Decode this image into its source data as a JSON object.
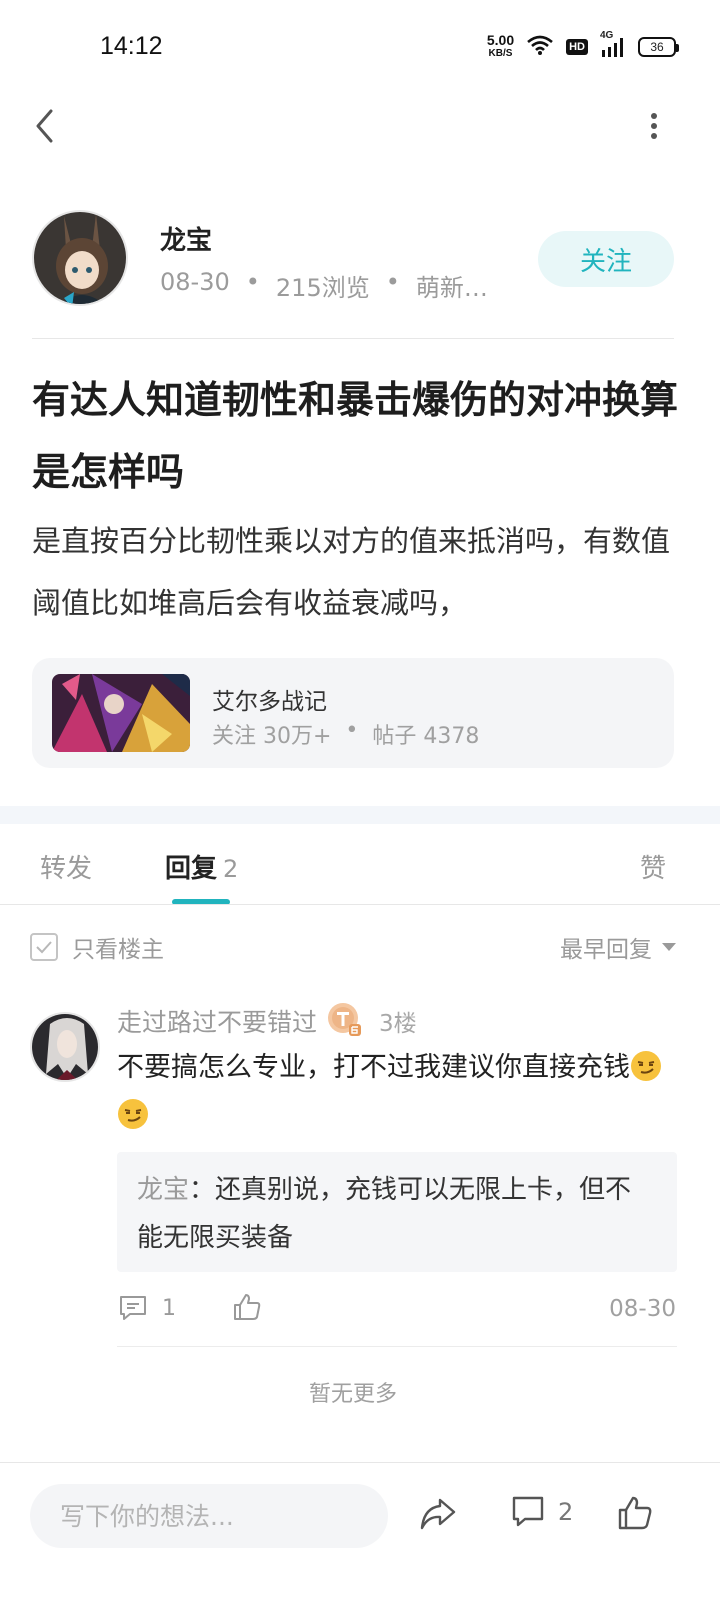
{
  "status_bar": {
    "time": "14:12",
    "net_speed": "5.00",
    "net_speed_unit": "KB/S",
    "hd": "HD",
    "signal": "4G",
    "battery": "36"
  },
  "author": {
    "name": "龙宝",
    "date": "08-30",
    "views": "215浏览",
    "tag": "萌新…",
    "follow_label": "关注"
  },
  "post": {
    "title": "有达人知道韧性和暴击爆伤的对冲换算是怎样吗",
    "body": "是直按百分比韧性乘以对方的值来抵消吗，有数值阈值比如堆高后会有收益衰减吗，"
  },
  "forum": {
    "name": "艾尔多战记",
    "followers": "关注 30万+",
    "posts": "帖子 4378"
  },
  "tabs": {
    "forward": "转发",
    "reply": "回复",
    "reply_count": "2",
    "like": "赞"
  },
  "filter": {
    "only_op": "只看楼主",
    "sort": "最早回复"
  },
  "comment": {
    "user": "走过路过不要错过",
    "floor": "3楼",
    "text": "不要搞怎么专业，打不过我建议你直接充钱",
    "sub_user": "龙宝",
    "sub_text": "：还真别说，充钱可以无限上卡，但不能无限买装备",
    "reply_count": "1",
    "date": "08-30"
  },
  "footer_note": "暂无更多",
  "bottom_bar": {
    "input_placeholder": "写下你的想法...",
    "comment_count": "2"
  },
  "colors": {
    "accent": "#21b4be",
    "follow_bg": "#e8f7f8",
    "card_bg": "#f4f5f7",
    "muted_text": "#9a9a9a"
  }
}
